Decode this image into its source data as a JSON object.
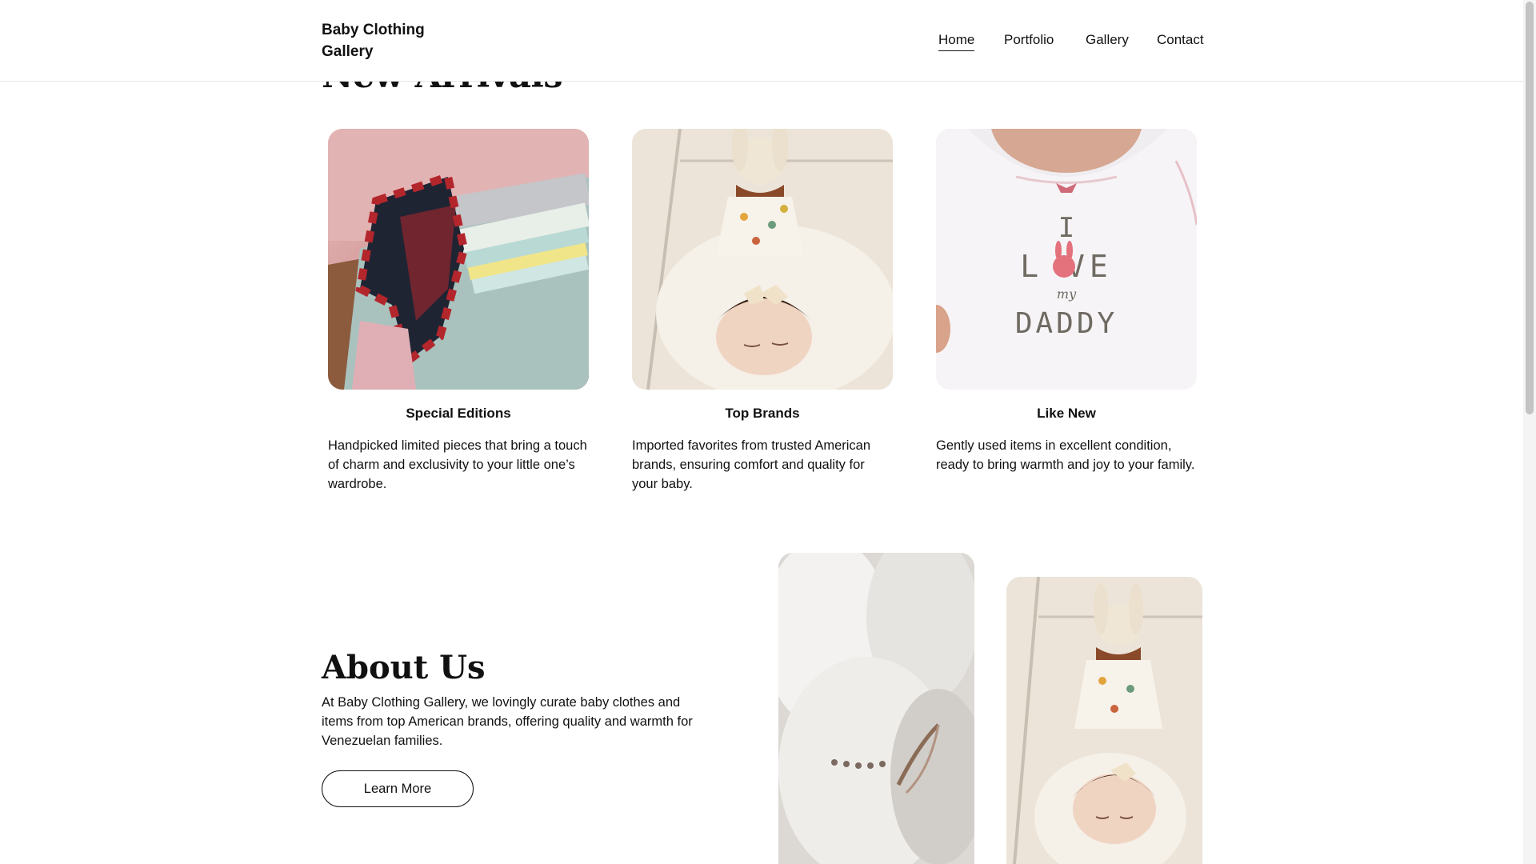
{
  "header": {
    "logo": "Baby Clothing Gallery",
    "nav": [
      {
        "label": "Home",
        "active": true
      },
      {
        "label": "Portfolio",
        "active": false
      },
      {
        "label": "Gallery",
        "active": false
      },
      {
        "label": "Contact",
        "active": false
      }
    ]
  },
  "new_arrivals": {
    "title": "New Arrivals",
    "cards": [
      {
        "title": "Special Editions",
        "text": "Handpicked limited pieces that bring a touch of charm and exclusivity to your little one’s wardrobe.",
        "image": "folded-baby-clothes-photo"
      },
      {
        "title": "Top Brands",
        "text": "Imported favorites from trusted American brands, ensuring comfort and quality for your baby.",
        "image": "sleeping-baby-with-bunny-doll-photo"
      },
      {
        "title": "Like New",
        "text": "Gently used items in excellent condition, ready to bring warmth and joy to your family.",
        "image": "i-love-my-daddy-onesie-photo"
      }
    ]
  },
  "about": {
    "title": "About Us",
    "text": "At Baby Clothing Gallery, we lovingly curate baby clothes and items from top American brands, offering quality and warmth for Venezuelan families.",
    "button": "Learn More",
    "images": [
      "fuzzy-baby-booties-photo",
      "sleeping-baby-with-bunny-doll-photo"
    ]
  },
  "onesie_print": {
    "line1": "I",
    "line2": "L VE",
    "line3": "my",
    "line4": "DADDY"
  }
}
